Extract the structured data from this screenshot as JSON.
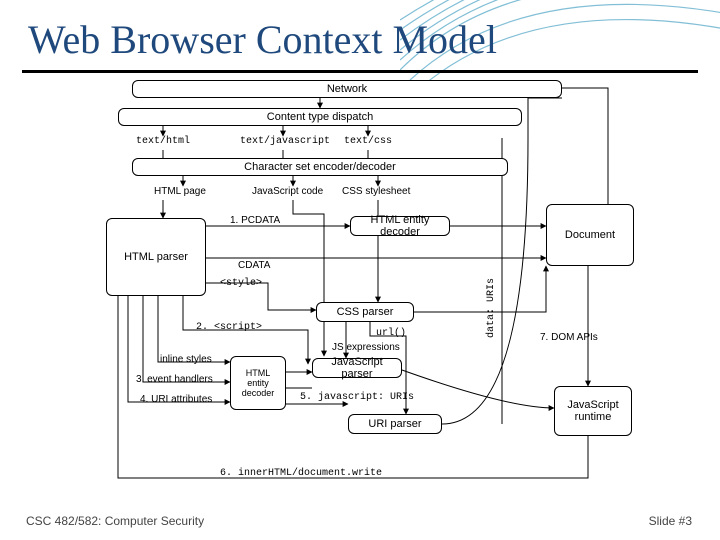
{
  "title": "Web Browser Context Model",
  "footer": {
    "course": "CSC 482/582: Computer Security",
    "slide": "Slide #3"
  },
  "boxes": {
    "network": "Network",
    "dispatch": "Content type dispatch",
    "encoder": "Character set encoder/decoder",
    "html_parser": "HTML parser",
    "entity_decoder": "HTML entity decoder",
    "document": "Document",
    "css_parser": "CSS parser",
    "js_parser": "JavaScript parser",
    "uri_parser": "URI parser",
    "html_entity_decoder_small": "HTML entity decoder",
    "js_runtime": "JavaScript runtime"
  },
  "labels": {
    "text_html": "text/html",
    "text_js": "text/javascript",
    "text_css": "text/css",
    "html_page": "HTML page",
    "js_code": "JavaScript code",
    "css_stylesheet": "CSS stylesheet",
    "pcdata": "1. PCDATA",
    "cdata": "CDATA",
    "style_tag": "<style>",
    "script_tag": "2. <script>",
    "url": "url()",
    "js_expr": "JS expressions",
    "inline_styles": "inline styles",
    "event_handlers": "3. event handlers",
    "uri_attrs": "4. URI attributes",
    "js_uris": "5. javascript: URIs",
    "innerhtml": "6. innerHTML/document.write",
    "data_uris": "data: URIs",
    "dom_apis": "7. DOM APIs"
  }
}
